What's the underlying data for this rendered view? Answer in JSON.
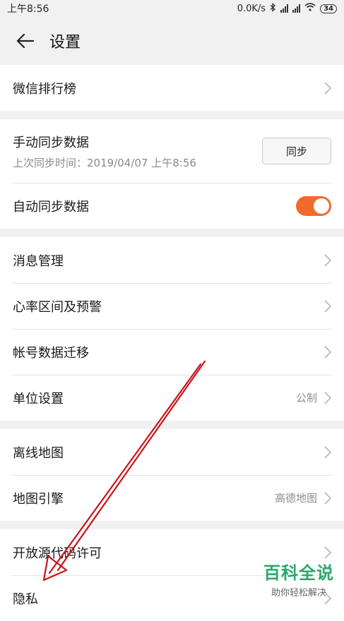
{
  "status_bar": {
    "time": "上午8:56",
    "network_speed": "0.0K/s",
    "battery": "34"
  },
  "header": {
    "title": "设置"
  },
  "groups": [
    {
      "items": [
        {
          "label": "微信排行榜"
        }
      ]
    },
    {
      "items": [
        {
          "label": "手动同步数据",
          "sub": "上次同步时间：2019/04/07 上午8:56",
          "button": "同步"
        },
        {
          "label": "自动同步数据",
          "toggle_on": true
        }
      ]
    },
    {
      "items": [
        {
          "label": "消息管理"
        },
        {
          "label": "心率区间及预警"
        },
        {
          "label": "帐号数据迁移"
        },
        {
          "label": "单位设置",
          "value": "公制"
        }
      ]
    },
    {
      "items": [
        {
          "label": "离线地图"
        },
        {
          "label": "地图引擎",
          "value": "高德地图"
        }
      ]
    },
    {
      "items": [
        {
          "label": "开放源代码许可"
        },
        {
          "label": "隐私"
        }
      ]
    }
  ],
  "colors": {
    "accent": "#f26a2b",
    "annotation_arrow": "#c8141c",
    "watermark": "#2aa86a"
  },
  "watermark": {
    "title": "百科全说",
    "subtitle": "助你轻松解决"
  }
}
